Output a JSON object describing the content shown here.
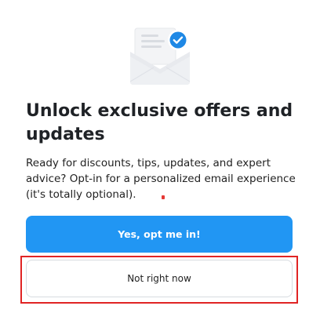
{
  "dialog": {
    "hero_icon": "envelope-check-icon",
    "title": "Unlock exclusive offers and updates",
    "body": "Ready for discounts, tips, updates, and expert advice? Opt-in for a personalized email experience (it's totally optional).",
    "primary_button_label": "Yes, opt me in!",
    "secondary_button_label": "Not right now"
  },
  "colors": {
    "primary": "#2196f3",
    "highlight": "#e02424",
    "check_badge": "#1e88e5"
  }
}
